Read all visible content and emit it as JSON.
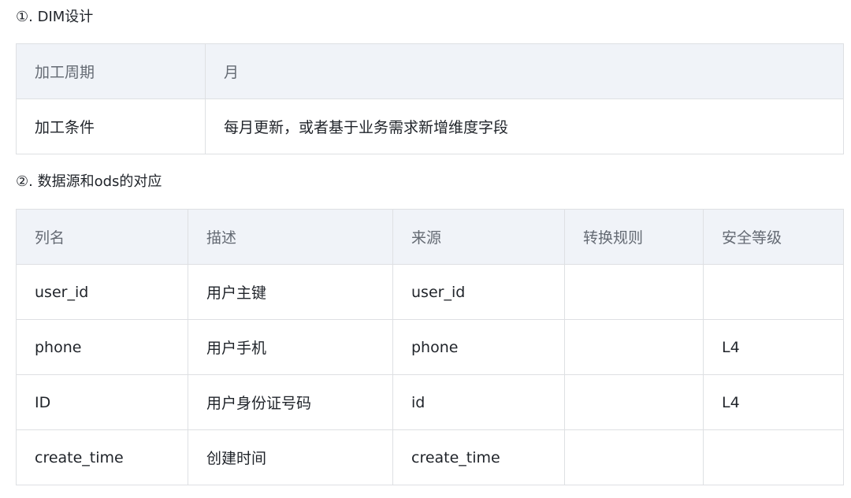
{
  "section1": {
    "heading": "①. DIM设计",
    "rows": [
      {
        "label": "加工周期",
        "value": "月"
      },
      {
        "label": "加工条件",
        "value": "每月更新，或者基于业务需求新增维度字段"
      }
    ]
  },
  "section2": {
    "heading": "②. 数据源和ods的对应",
    "columns": [
      "列名",
      "描述",
      "来源",
      "转换规则",
      "安全等级"
    ],
    "rows": [
      [
        "user_id",
        "用户主键",
        "user_id",
        "",
        ""
      ],
      [
        "phone",
        "用户手机",
        "phone",
        "",
        "L4"
      ],
      [
        "ID",
        "用户身份证号码",
        "id",
        "",
        "L4"
      ],
      [
        "create_time",
        "创建时间",
        "create_time",
        "",
        ""
      ]
    ]
  }
}
